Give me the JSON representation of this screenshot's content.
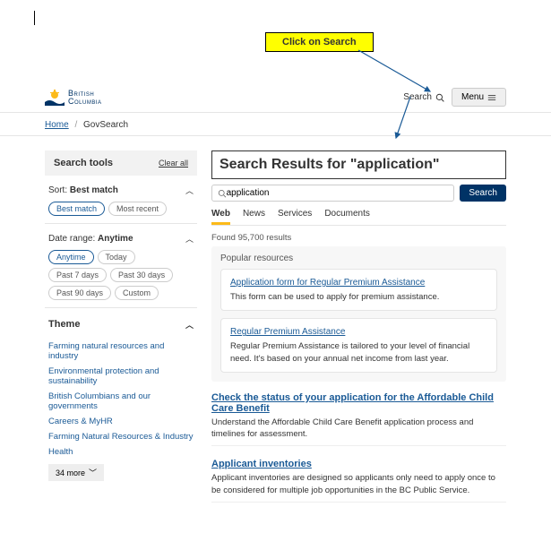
{
  "annotation": {
    "label": "Click on Search"
  },
  "header": {
    "logo_text_1": "British",
    "logo_text_2": "Columbia",
    "search_label": "Search",
    "menu_label": "Menu"
  },
  "breadcrumb": {
    "home": "Home",
    "current": "GovSearch"
  },
  "sidebar": {
    "tools_title": "Search tools",
    "clear": "Clear all",
    "sort": {
      "label": "Sort:",
      "value": "Best match",
      "options": [
        "Best match",
        "Most recent"
      ],
      "selected": 0
    },
    "date": {
      "label": "Date range:",
      "value": "Anytime",
      "options": [
        "Anytime",
        "Today",
        "Past 7 days",
        "Past 30 days",
        "Past 90 days",
        "Custom"
      ],
      "selected": 0
    },
    "theme": {
      "title": "Theme",
      "items": [
        "Farming natural resources and industry",
        "Environmental protection and sustainability",
        "British Columbians and our governments",
        "Careers & MyHR",
        "Farming Natural Resources & Industry",
        "Health"
      ],
      "more": "34 more"
    }
  },
  "main": {
    "title": "Search Results for \"application\"",
    "search_value": "application",
    "search_btn": "Search",
    "tabs": [
      "Web",
      "News",
      "Services",
      "Documents"
    ],
    "active_tab": 0,
    "found": "Found 95,700 results",
    "popular_title": "Popular resources",
    "popular": [
      {
        "title": "Application form for Regular Premium Assistance",
        "desc": "This form can be used to apply for premium assistance."
      },
      {
        "title": "Regular Premium Assistance",
        "desc": "Regular Premium Assistance is tailored to your level of financial need. It's based on your annual net income from last year."
      }
    ],
    "results": [
      {
        "title": "Check the status of your application for the Affordable Child Care Benefit",
        "desc": "Understand the Affordable Child Care Benefit application process and timelines for assessment."
      },
      {
        "title": "Applicant inventories",
        "desc": "Applicant inventories are designed so applicants only need to apply once to be considered for multiple job opportunities in the BC Public Service."
      }
    ]
  }
}
